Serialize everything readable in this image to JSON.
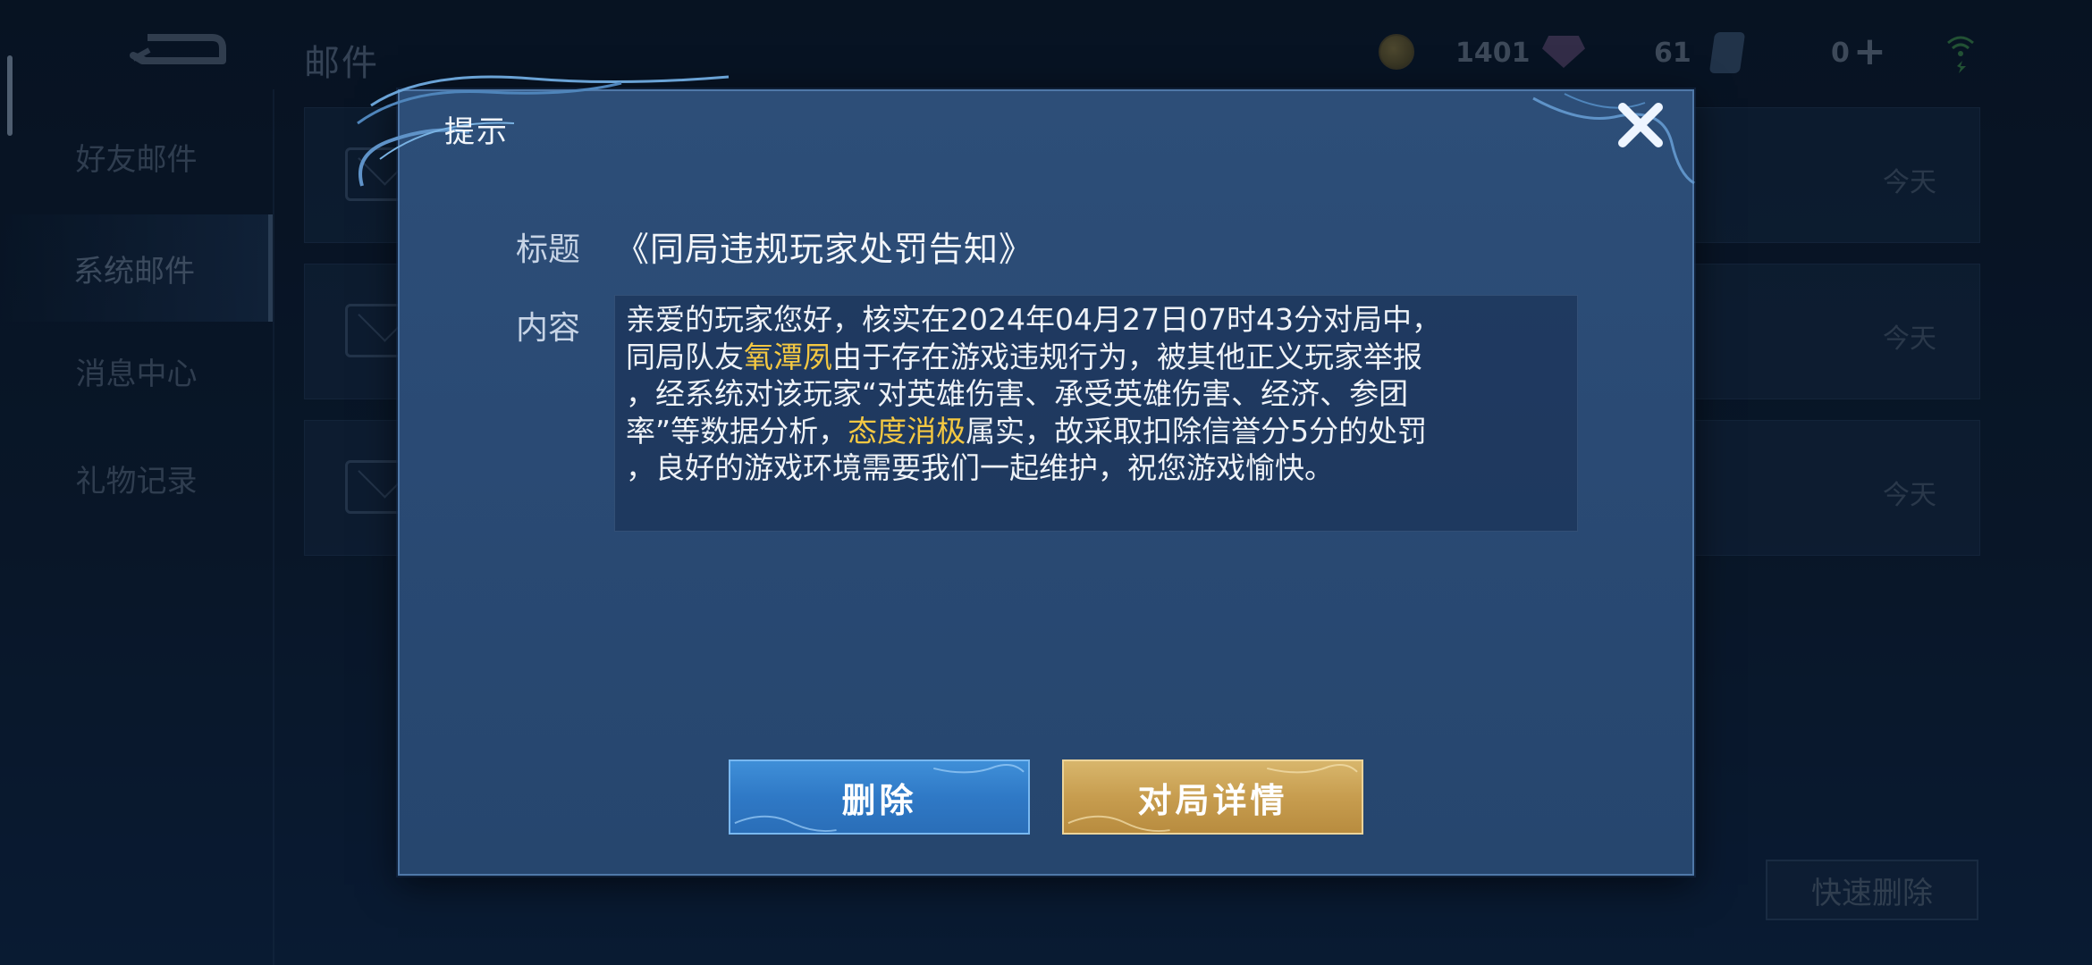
{
  "header": {
    "title": "邮件",
    "coins": "1401",
    "gems": "61",
    "tickets": "0"
  },
  "sidebar": {
    "items": [
      {
        "label": "好友邮件"
      },
      {
        "label": "系统邮件"
      },
      {
        "label": "消息中心"
      },
      {
        "label": "礼物记录"
      }
    ]
  },
  "mail_list": {
    "rows": [
      {
        "date": "今天"
      },
      {
        "date": "今天"
      },
      {
        "date": "今天"
      }
    ],
    "quick_delete": "快速删除"
  },
  "dialog": {
    "title": "提示",
    "subject_label": "标题",
    "subject": "《同局违规玩家处罚告知》",
    "content_label": "内容",
    "content": {
      "lines": [
        [
          "亲爱的玩家您好，核实在2024年04月27日07时43分对局中，"
        ],
        [
          "同局队友",
          "氧潭夙",
          "由于存在游戏违规行为，被其他正义玩家举报"
        ],
        [
          "，经系统对该玩家“对英雄伤害、承受英雄伤害、经济、参团"
        ],
        [
          "率”等数据分析，",
          "态度消极",
          "属实，故采取扣除信誉分5分的处罚"
        ],
        [
          "，良好的游戏环境需要我们一起维护，祝您游戏愉快。"
        ]
      ]
    },
    "delete_button": "删除",
    "detail_button": "对局详情"
  },
  "colors": {
    "highlight": "#f4c842",
    "delete_button": "#2f79c6",
    "detail_button": "#c79d4f",
    "dialog_bg": "#2a4a74"
  },
  "icons": [
    "back-arrow-icon",
    "coin-icon",
    "gem-icon",
    "ticket-icon",
    "plus-icon",
    "wifi-icon",
    "close-icon",
    "envelope-icon"
  ]
}
